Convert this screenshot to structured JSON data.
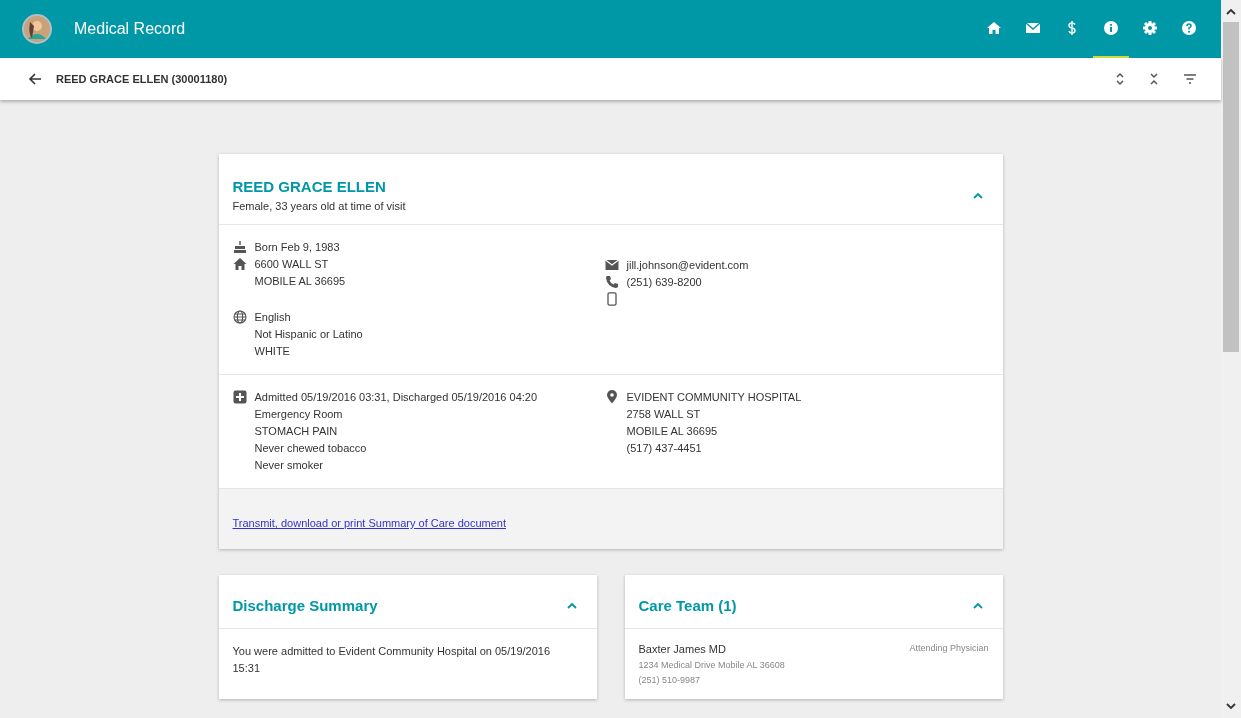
{
  "app_bar": {
    "title": "Medical Record",
    "nav": [
      {
        "kind": "home",
        "selected": false
      },
      {
        "kind": "mail",
        "selected": false
      },
      {
        "kind": "billing",
        "selected": false
      },
      {
        "kind": "info",
        "selected": true
      },
      {
        "kind": "settings",
        "selected": false
      },
      {
        "kind": "help",
        "selected": false
      }
    ]
  },
  "sub_header": {
    "title": "REED GRACE ELLEN (30001180)"
  },
  "patient_card": {
    "name": "REED GRACE ELLEN",
    "subtitle": "Female, 33 years old at time of visit",
    "expanded": true,
    "left": [
      {
        "kind": "birth",
        "lines": [
          "Born Feb 9, 1983"
        ]
      },
      {
        "kind": "home",
        "lines": [
          "6600 WALL ST",
          "MOBILE AL 36695"
        ]
      },
      {
        "kind": "language",
        "lines": [
          "English",
          "Not Hispanic or Latino",
          "WHITE"
        ]
      }
    ],
    "right": [
      {
        "kind": "mail",
        "lines": [
          "jill.johnson@evident.com"
        ]
      },
      {
        "kind": "phone",
        "lines": [
          "(251) 639-8200"
        ]
      },
      {
        "kind": "mobile"
      }
    ],
    "visit": {
      "lines": [
        "Admitted 05/19/2016 03:31, Discharged 05/19/2016 04:20",
        "Emergency Room",
        "STOMACH PAIN",
        "Never chewed tobacco",
        "Never smoker"
      ]
    },
    "facility": {
      "lines": [
        "EVIDENT COMMUNITY HOSPITAL",
        "2758 WALL ST",
        "MOBILE AL 36695",
        "(517) 437-4451"
      ]
    },
    "link": "Transmit, download or print Summary of Care document"
  },
  "discharge_summary": {
    "title": "Discharge Summary",
    "expanded": true,
    "text": "You were admitted to Evident Community Hospital on 05/19/2016 15:31"
  },
  "care_team": {
    "title": "Care Team (1)",
    "expanded": true,
    "members": [
      {
        "name": "Baxter James MD",
        "role": "Attending Physician",
        "address": "1234 Medical Drive Mobile AL 36608",
        "phone": "(251) 510-9987"
      }
    ]
  }
}
